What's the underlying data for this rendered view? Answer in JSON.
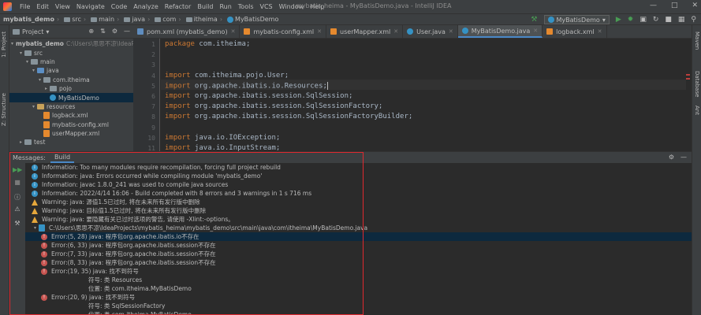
{
  "menubar": {
    "items": [
      "File",
      "Edit",
      "View",
      "Navigate",
      "Code",
      "Analyze",
      "Refactor",
      "Build",
      "Run",
      "Tools",
      "VCS",
      "Window",
      "Help"
    ],
    "window_title": "mybatis_heima - MyBatisDemo.java - IntelliJ IDEA"
  },
  "navbar": {
    "crumbs": [
      "mybatis_demo",
      "src",
      "main",
      "java",
      "com",
      "itheima",
      "MyBatisDemo"
    ],
    "run_config": "MyBatisDemo"
  },
  "left_tabs": [
    "1: Project",
    "Z: Structure"
  ],
  "right_tabs": [
    "Maven",
    "Database",
    "Ant"
  ],
  "project_panel": {
    "title": "Project",
    "tree": [
      {
        "label": "mybatis_demo",
        "extra": "C:\\Users\\思思不凉\\IdeaProject",
        "depth": 0,
        "icon": "folder",
        "open": true
      },
      {
        "label": "src",
        "depth": 1,
        "icon": "folder",
        "open": true
      },
      {
        "label": "main",
        "depth": 2,
        "icon": "folder",
        "open": true
      },
      {
        "label": "java",
        "depth": 3,
        "icon": "folder-blue",
        "open": true
      },
      {
        "label": "com.itheima",
        "depth": 4,
        "icon": "package",
        "open": true
      },
      {
        "label": "pojo",
        "depth": 5,
        "icon": "package",
        "open": false
      },
      {
        "label": "MyBatisDemo",
        "depth": 5,
        "icon": "class",
        "selected": true
      },
      {
        "label": "resources",
        "depth": 3,
        "icon": "folder-orange",
        "open": true
      },
      {
        "label": "logback.xml",
        "depth": 4,
        "icon": "xml"
      },
      {
        "label": "mybatis-config.xml",
        "depth": 4,
        "icon": "xml"
      },
      {
        "label": "userMapper.xml",
        "depth": 4,
        "icon": "xml"
      },
      {
        "label": "test",
        "depth": 1,
        "icon": "folder",
        "open": false
      }
    ]
  },
  "editor_tabs": [
    {
      "label": "pom.xml (mybatis_demo)",
      "icon_color": "#5f8dbf",
      "active": false
    },
    {
      "label": "mybatis-config.xml",
      "icon_color": "#e5892e",
      "active": false
    },
    {
      "label": "userMapper.xml",
      "icon_color": "#e5892e",
      "active": false
    },
    {
      "label": "User.java",
      "icon_color": "#3592c4",
      "active": false
    },
    {
      "label": "MyBatisDemo.java",
      "icon_color": "#3592c4",
      "active": true
    },
    {
      "label": "logback.xml",
      "icon_color": "#e5892e",
      "active": false
    }
  ],
  "editor": {
    "line_numbers": [
      "1",
      "2",
      "3",
      "4",
      "5",
      "6",
      "7",
      "8",
      "9",
      "10",
      "11"
    ],
    "lines": [
      {
        "kw": "package",
        "rest": " com.itheima;"
      },
      {
        "kw": "",
        "rest": ""
      },
      {
        "kw": "",
        "rest": ""
      },
      {
        "kw": "import",
        "rest": " com.itheima.pojo.User;"
      },
      {
        "kw": "import",
        "rest": " org.apache.ibatis.io.Resources;"
      },
      {
        "kw": "import",
        "rest": " org.apache.ibatis.session.SqlSession;"
      },
      {
        "kw": "import",
        "rest": " org.apache.ibatis.session.SqlSessionFactory;"
      },
      {
        "kw": "import",
        "rest": " org.apache.ibatis.session.SqlSessionFactoryBuilder;"
      },
      {
        "kw": "",
        "rest": ""
      },
      {
        "kw": "import",
        "rest": " java.io.IOException;"
      },
      {
        "kw": "import",
        "rest": " java.io.InputStream;"
      }
    ]
  },
  "build_panel": {
    "label": "Messages:",
    "tab": "Build",
    "messages": [
      {
        "type": "info",
        "text": "Information: Too many modules require recompilation, forcing full project rebuild",
        "indent": 0
      },
      {
        "type": "info",
        "text": "Information: java: Errors occurred while compiling module 'mybatis_demo'",
        "indent": 0
      },
      {
        "type": "info",
        "text": "Information: javac 1.8.0_241 was used to compile java sources",
        "indent": 0
      },
      {
        "type": "info",
        "text": "Information: 2022/4/14 16:06 - Build completed with 8 errors and 3 warnings in 1 s 716 ms",
        "indent": 0
      },
      {
        "type": "warn",
        "text": "Warning: java: 源值1.5已过时, 将在未来所有发行版中删除",
        "indent": 0
      },
      {
        "type": "warn",
        "text": "Warning: java: 目标值1.5已过时, 将在未来所有发行版中删除",
        "indent": 0
      },
      {
        "type": "warn",
        "text": "Warning: java: 要隐藏有关已过时选项的警告, 请使用 -Xlint:-options。",
        "indent": 0
      },
      {
        "type": "file",
        "text": "C:\\Users\\思思不凉\\IdeaProjects\\mybatis_heima\\mybatis_demo\\src\\main\\java\\com\\itheima\\MyBatisDemo.java",
        "indent": 0
      },
      {
        "type": "error",
        "text": "Error:(5, 28)  java: 程序包org.apache.ibatis.io不存在",
        "indent": 1,
        "selected": true
      },
      {
        "type": "error",
        "text": "Error:(6, 33)  java: 程序包org.apache.ibatis.session不存在",
        "indent": 1
      },
      {
        "type": "error",
        "text": "Error:(7, 33)  java: 程序包org.apache.ibatis.session不存在",
        "indent": 1
      },
      {
        "type": "error",
        "text": "Error:(8, 33)  java: 程序包org.apache.ibatis.session不存在",
        "indent": 1
      },
      {
        "type": "error",
        "text": "Error:(19, 35)  java: 找不到符号",
        "indent": 1
      },
      {
        "type": "text",
        "text": "符号:   类 Resources",
        "indent": 2
      },
      {
        "type": "text",
        "text": "位置: 类 com.itheima.MyBatisDemo",
        "indent": 2
      },
      {
        "type": "error",
        "text": "Error:(20, 9)  java: 找不到符号",
        "indent": 1
      },
      {
        "type": "text",
        "text": "符号: 类 SqlSessionFactory",
        "indent": 2
      },
      {
        "type": "text",
        "text": "位置: 类 com.itheima.MyBatisDemo",
        "indent": 2
      }
    ]
  }
}
